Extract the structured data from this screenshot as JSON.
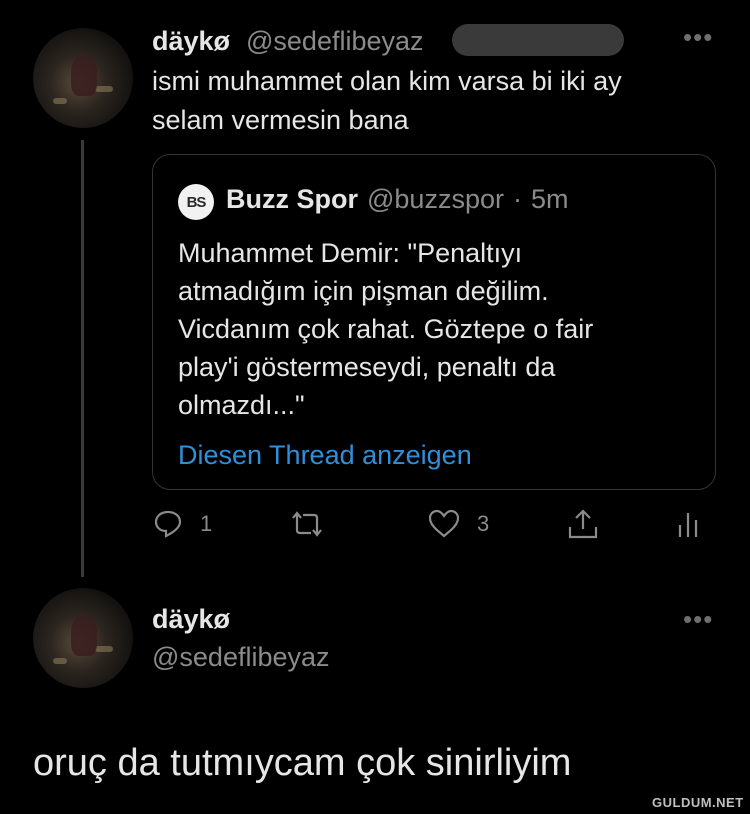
{
  "tweet": {
    "author_name": "däykø",
    "author_handle": "@sedeflibeyaz",
    "more_icon": "more-horizontal-icon",
    "text_line1": "ismi muhammet olan kim varsa bi iki ay",
    "text_line2": "selam vermesin bana",
    "quoted": {
      "logo_text": "BS",
      "name": "Buzz Spor",
      "handle": "@buzzspor",
      "separator": "·",
      "time": "5m",
      "lines": [
        "Muhammet Demir: \"Penaltıyı",
        "atmadığım için pişman değilim.",
        "Vicdanım çok rahat. Göztepe o fair",
        "play'i göstermeseydi, penaltı da",
        "olmazdı...\""
      ],
      "thread_link": "Diesen Thread anzeigen"
    },
    "actions": {
      "reply_icon": "reply-icon",
      "reply_count": "1",
      "retweet_icon": "retweet-icon",
      "like_icon": "heart-icon",
      "like_count": "3",
      "share_icon": "share-icon",
      "analytics_icon": "analytics-icon"
    }
  },
  "reply": {
    "author_name": "däykø",
    "author_handle": "@sedeflibeyaz",
    "more_icon": "more-horizontal-icon",
    "text": "oruç da tutmıycam çok sinirliyim"
  },
  "watermark": "GULDUM.NET",
  "colors": {
    "background": "#000000",
    "link": "#2f8fd8",
    "secondary_text": "#8b8b8b"
  }
}
